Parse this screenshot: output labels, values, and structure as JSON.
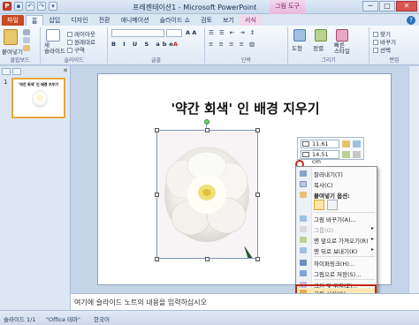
{
  "window": {
    "title": "프레젠테이션1 - Microsoft PowerPoint",
    "context_tools_label": "그림 도구",
    "controls": [
      "─",
      "□",
      "✕"
    ]
  },
  "tabs": [
    {
      "label": "파일",
      "kind": "file"
    },
    {
      "label": "홈",
      "kind": "active"
    },
    {
      "label": "삽입",
      "kind": "normal"
    },
    {
      "label": "디자인",
      "kind": "normal"
    },
    {
      "label": "전환",
      "kind": "normal"
    },
    {
      "label": "애니메이션",
      "kind": "normal"
    },
    {
      "label": "슬라이드 쇼",
      "kind": "normal"
    },
    {
      "label": "검토",
      "kind": "normal"
    },
    {
      "label": "보기",
      "kind": "normal"
    },
    {
      "label": "서식",
      "kind": "ctx"
    }
  ],
  "ribbon": {
    "clipboard": {
      "paste": "붙여넣기",
      "label": "클립보드"
    },
    "slides": {
      "new_slide": "새\n슬라이드",
      "layout": "레이아웃",
      "reset": "원래대로",
      "section": "구역",
      "label": "슬라이드"
    },
    "font": {
      "label": "글꼴"
    },
    "paragraph": {
      "label": "단락"
    },
    "drawing": {
      "shape": "도형",
      "arrange": "정렬",
      "quick_styles": "빠른\n스타일",
      "label": "그리기"
    },
    "editing": {
      "find": "찾기",
      "replace": "바꾸기",
      "select": "선택",
      "label": "편집"
    }
  },
  "left_panel": {
    "slide_number": "1",
    "thumb_title": "'약간 회색' 인 배경 지우기",
    "close": "✕"
  },
  "slide": {
    "title": "'약간 회색' 인 배경 지우기"
  },
  "size_toolbar": {
    "height": "11.61 cm",
    "width": "14.51 cm"
  },
  "context_menu": {
    "items": [
      {
        "label": "잘라내기(T)",
        "icon": "scissors-icon",
        "dim": false
      },
      {
        "label": "복사(C)",
        "icon": "copy-icon",
        "dim": false
      },
      {
        "label": "붙여넣기 옵션:",
        "icon": "paste-icon",
        "dim": false,
        "bold": true
      },
      {
        "label": "그림 바꾸기(A)...",
        "icon": "picture-icon",
        "dim": false
      },
      {
        "label": "그룹(G)",
        "icon": "group-icon",
        "dim": true,
        "submenu": true
      },
      {
        "label": "맨 앞으로 가져오기(R)",
        "icon": "bring-front-icon",
        "dim": false,
        "submenu": true
      },
      {
        "label": "맨 뒤로 보내기(K)",
        "icon": "send-back-icon",
        "dim": false,
        "submenu": true
      },
      {
        "label": "하이퍼링크(H)...",
        "icon": "hyperlink-icon",
        "dim": false
      },
      {
        "label": "그림으로 저장(S)...",
        "icon": "save-icon",
        "dim": false
      },
      {
        "label": "크기 및 위치(Z)...",
        "icon": "size-icon",
        "dim": false
      },
      {
        "label": "그림 서식(O)...",
        "icon": "format-picture-icon",
        "dim": false
      }
    ]
  },
  "notes": {
    "placeholder": "여기에 슬라이드 노트의 내용을 입력하십시오"
  },
  "status": {
    "slide": "슬라이드 1/1",
    "theme": "\"Office 테마\"",
    "language": "한국어"
  }
}
